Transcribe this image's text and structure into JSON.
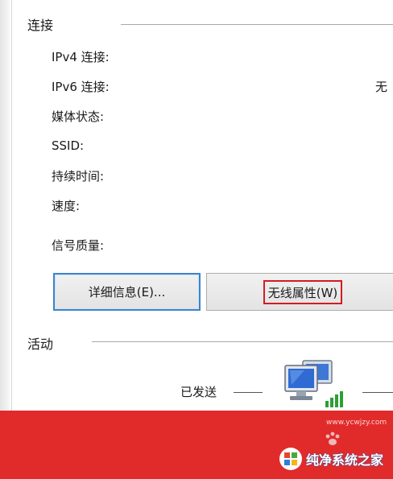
{
  "connection": {
    "title": "连接",
    "rows": [
      {
        "label": "IPv4 连接:",
        "value": ""
      },
      {
        "label": "IPv6 连接:",
        "value": "无"
      },
      {
        "label": "媒体状态:",
        "value": ""
      },
      {
        "label": "SSID:",
        "value": ""
      },
      {
        "label": "持续时间:",
        "value": ""
      },
      {
        "label": "速度:",
        "value": ""
      }
    ],
    "signal_label": "信号质量:"
  },
  "buttons": {
    "details_label": "详细信息(E)...",
    "wireless_label": "无线属性(W)"
  },
  "activity": {
    "title": "活动",
    "sent_label": "已发送"
  },
  "watermark": {
    "brand": "纯净系统之家",
    "url": "www.ycwjzy.com"
  },
  "colors": {
    "accent_blue": "#3d84c9",
    "highlight_red": "#d51b22",
    "banner_red": "#e12b2b"
  },
  "icons": {
    "network": "network-computer-icon",
    "signal": "signal-bars-icon",
    "logo": "windows-logo-icon"
  }
}
